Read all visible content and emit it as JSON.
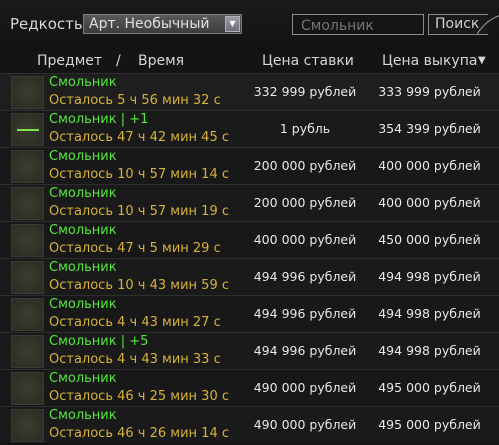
{
  "filter": {
    "rarity_label": "Редкость",
    "rarity_value": "Арт. Необычный",
    "search_placeholder": "Смольник",
    "search_button": "Поиск"
  },
  "columns": {
    "item": "Предмет",
    "separator": "/",
    "time": "Время",
    "bid": "Цена ставки",
    "buyout": "Цена выкупа",
    "sort_indicator": "▼"
  },
  "rows": [
    {
      "name": "Смольник",
      "time": "Осталось 5 ч 56 мин 32 с",
      "bid": "332 999 рублей",
      "buyout": "333 999 рублей"
    },
    {
      "name": "Смольник | +1",
      "time": "Осталось 47 ч 42 мин 45 с",
      "bid": "1 рубль",
      "buyout": "354 399 рублей"
    },
    {
      "name": "Смольник",
      "time": "Осталось 10 ч 57 мин 14 с",
      "bid": "200 000 рублей",
      "buyout": "400 000 рублей"
    },
    {
      "name": "Смольник",
      "time": "Осталось 10 ч 57 мин 19 с",
      "bid": "200 000 рублей",
      "buyout": "400 000 рублей"
    },
    {
      "name": "Смольник",
      "time": "Осталось 47 ч 5 мин 29 с",
      "bid": "400 000 рублей",
      "buyout": "450 000 рублей"
    },
    {
      "name": "Смольник",
      "time": "Осталось 10 ч 43 мин 59 с",
      "bid": "494 996 рублей",
      "buyout": "494 998 рублей"
    },
    {
      "name": "Смольник",
      "time": "Осталось 4 ч 43 мин 27 с",
      "bid": "494 996 рублей",
      "buyout": "494 998 рублей"
    },
    {
      "name": "Смольник | +5",
      "time": "Осталось 4 ч 43 мин 33 с",
      "bid": "494 996 рублей",
      "buyout": "494 998 рублей"
    },
    {
      "name": "Смольник",
      "time": "Осталось 46 ч 25 мин 30 с",
      "bid": "490 000 рублей",
      "buyout": "495 000 рублей"
    },
    {
      "name": "Смольник",
      "time": "Осталось 46 ч 26 мин 14 с",
      "bid": "490 000 рублей",
      "buyout": "495 000 рублей"
    }
  ]
}
